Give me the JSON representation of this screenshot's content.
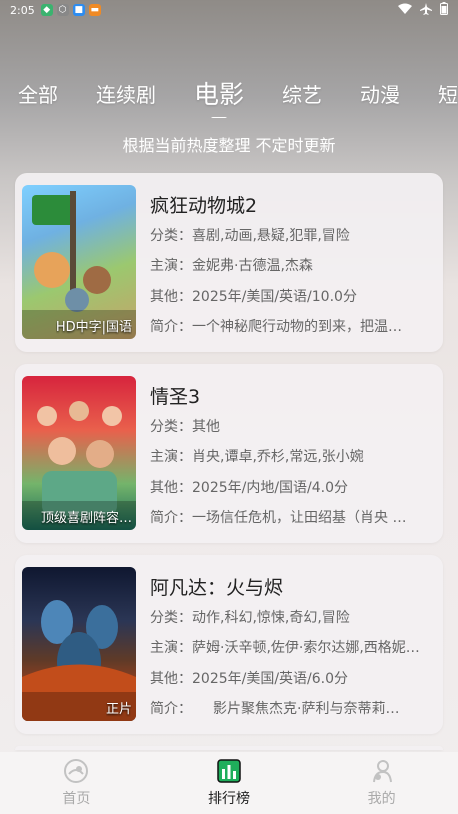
{
  "status": {
    "time": "2:05"
  },
  "tabs": [
    {
      "label": "全部"
    },
    {
      "label": "连续剧"
    },
    {
      "label": "电影"
    },
    {
      "label": "综艺"
    },
    {
      "label": "动漫"
    },
    {
      "label": "短剧"
    }
  ],
  "subtitle": "根据当前热度整理 不定时更新",
  "movies": [
    {
      "title": "疯狂动物城2",
      "category": "分类：喜剧,动画,悬疑,犯罪,冒险",
      "cast": "主演：金妮弗·古德温,杰森",
      "other": "其他：2025年/美国/英语/10.0分",
      "intro": "简介：一个神秘爬行动物的到来，把温…",
      "badge": "HD中字|国语"
    },
    {
      "title": "情圣3",
      "category": "分类：其他",
      "cast": "主演：肖央,谭卓,乔杉,常远,张小婉",
      "other": "其他：2025年/内地/国语/4.0分",
      "intro": "简介：一场信任危机，让田绍基（肖央 …",
      "badge": "顶级喜剧阵容…"
    },
    {
      "title": "阿凡达：火与烬",
      "category": "分类：动作,科幻,惊悚,奇幻,冒险",
      "cast": "主演：萨姆·沃辛顿,佐伊·索尔达娜,西格妮…",
      "other": "其他：2025年/美国/英语/6.0分",
      "intro": "简介：　　影片聚焦杰克·萨利与奈蒂莉…",
      "badge": "正片"
    }
  ],
  "nav": [
    {
      "label": "首页"
    },
    {
      "label": "排行榜"
    },
    {
      "label": "我的"
    }
  ],
  "colors": {
    "accent": "#1fae5b",
    "nav_inactive": "#aaaaaa"
  }
}
